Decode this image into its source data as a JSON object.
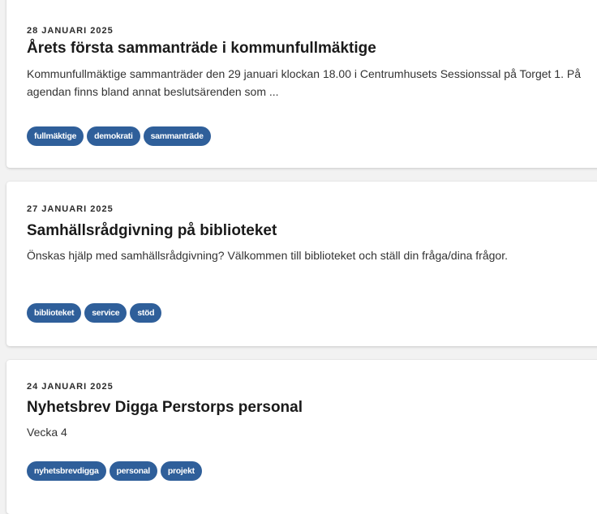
{
  "news": {
    "items": [
      {
        "date": "28 JANUARI 2025",
        "title": "Årets första sammanträde i kommunfullmäktige",
        "excerpt": "Kommunfullmäktige sammanträder den 29 januari klockan 18.00 i Centrumhusets Sessionssal på Torget 1. På agendan finns bland annat beslutsärenden som ...",
        "tags": [
          "fullmäktige",
          "demokrati",
          "sammanträde"
        ]
      },
      {
        "date": "27 JANUARI 2025",
        "title": "Samhällsrådgivning på biblioteket",
        "excerpt": "Önskas hjälp med samhällsrådgivning? Välkommen till biblioteket och ställ din fråga/dina frågor.",
        "tags": [
          "biblioteket",
          "service",
          "stöd"
        ]
      },
      {
        "date": "24 JANUARI 2025",
        "title": "Nyhetsbrev Digga Perstorps personal",
        "excerpt": "Vecka 4",
        "tags": [
          "nyhetsbrevdigga",
          "personal",
          "projekt"
        ]
      }
    ]
  },
  "colors": {
    "tag_background": "#2f5f9a",
    "page_background": "#f2f2f2",
    "card_background": "#ffffff"
  }
}
